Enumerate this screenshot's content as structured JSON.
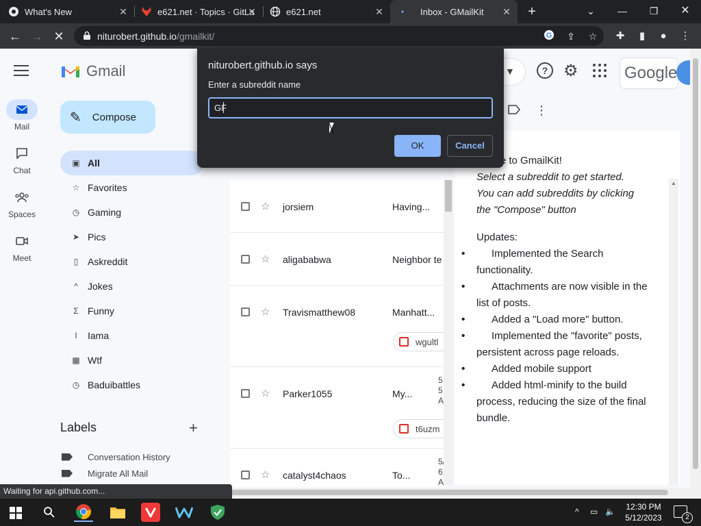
{
  "browser": {
    "tabs": [
      {
        "title": "What's New"
      },
      {
        "title": "e621.net · Topics · GitLa"
      },
      {
        "title": "e621.net"
      },
      {
        "title": "Inbox - GMailKit"
      }
    ],
    "url_host": "niturobert.github.io",
    "url_path": "/gmailkit/",
    "status": "Waiting for api.github.com..."
  },
  "rail": {
    "items": [
      {
        "label": "Mail"
      },
      {
        "label": "Chat"
      },
      {
        "label": "Spaces"
      },
      {
        "label": "Meet"
      }
    ]
  },
  "app": {
    "logo_text": "Gmail",
    "compose_label": "Compose",
    "google_text": "Google"
  },
  "nav": {
    "items": [
      {
        "label": "All"
      },
      {
        "label": "Favorites"
      },
      {
        "label": "Gaming"
      },
      {
        "label": "Pics"
      },
      {
        "label": "Askreddit"
      },
      {
        "label": "Jokes"
      },
      {
        "label": "Funny"
      },
      {
        "label": "Iama"
      },
      {
        "label": "Wtf"
      },
      {
        "label": "Baduibattles"
      }
    ]
  },
  "labels": {
    "title": "Labels",
    "items": [
      {
        "label": "Conversation History"
      },
      {
        "label": "Migrate All Mail"
      }
    ]
  },
  "list": {
    "rows": [
      {
        "sender": "jorsiem",
        "subject": "Having..."
      },
      {
        "sender": "aligababwa",
        "subject": "Neighbor te"
      },
      {
        "sender": "Travismatthew08",
        "subject": "Manhatt...",
        "attachment": "wgultl"
      },
      {
        "sender": "Parker1055",
        "subject": "My...",
        "date_lines": [
          "5",
          "5",
          "A"
        ],
        "attachment": "t6uzm"
      },
      {
        "sender": "catalyst4chaos",
        "subject": "To...",
        "date_lines": [
          "5/1",
          "6:5",
          "AM"
        ]
      }
    ]
  },
  "reader": {
    "welcome": "ome to GmailKit!",
    "intro_lines": [
      "Select a subreddit to get started.",
      "You can add subreddits by clicking",
      "the \"Compose\" button"
    ],
    "updates_title": "Updates:",
    "updates": [
      "Implemented the Search functionality.",
      "Attachments are now visible in the list of posts.",
      "Added a \"Load more\" button.",
      "Implemented the \"favorite\" posts, persistent across page reloads.",
      "Added mobile support",
      "Added html-minify to the build process, reducing the size of the final bundle."
    ]
  },
  "dialog": {
    "title": "niturobert.github.io says",
    "message": "Enter a subreddit name",
    "input_value": "GF",
    "ok_label": "OK",
    "cancel_label": "Cancel"
  },
  "taskbar": {
    "time": "12:30 PM",
    "date": "5/12/2023",
    "notification_count": "2"
  }
}
